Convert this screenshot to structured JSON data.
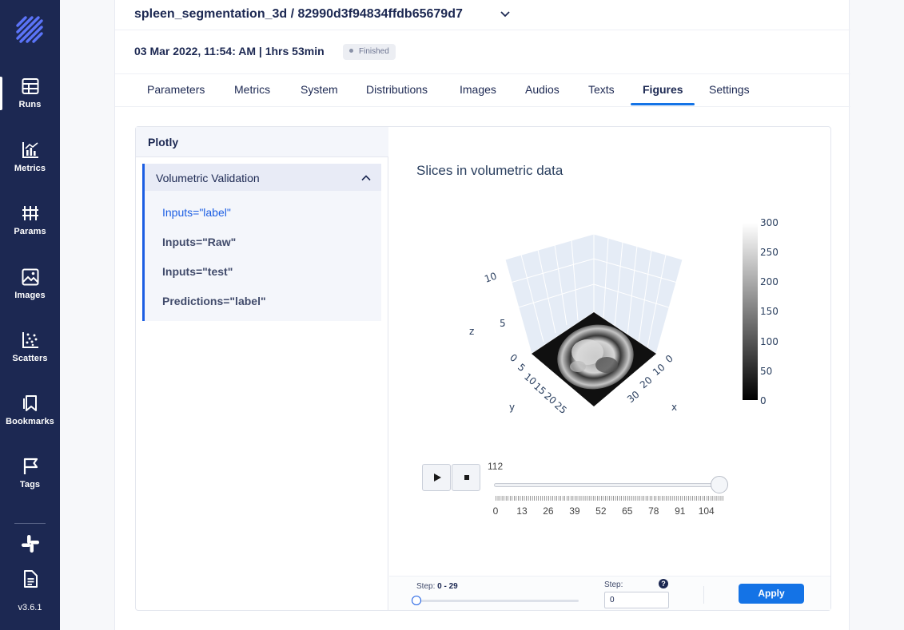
{
  "sidebar": {
    "items": [
      {
        "label": "Runs",
        "icon": "table-icon",
        "active": true
      },
      {
        "label": "Metrics",
        "icon": "bar-chart-icon",
        "active": false
      },
      {
        "label": "Params",
        "icon": "params-icon",
        "active": false
      },
      {
        "label": "Images",
        "icon": "image-icon",
        "active": false
      },
      {
        "label": "Scatters",
        "icon": "scatter-icon",
        "active": false
      },
      {
        "label": "Bookmarks",
        "icon": "bookmark-icon",
        "active": false
      },
      {
        "label": "Tags",
        "icon": "flag-icon",
        "active": false
      }
    ],
    "bottom_icons": [
      "slack-icon",
      "docs-icon"
    ],
    "version": "v3.6.1"
  },
  "header": {
    "run_title": "spleen_segmentation_3d / 82990d3f94834ffdb65679d7"
  },
  "meta": {
    "date": "03 Mar 2022, 11:54: AM | 1hrs 53min",
    "status": "Finished"
  },
  "tabs": [
    {
      "label": "Parameters"
    },
    {
      "label": "Metrics"
    },
    {
      "label": "System"
    },
    {
      "label": "Distributions"
    },
    {
      "label": "Images"
    },
    {
      "label": "Audios"
    },
    {
      "label": "Texts"
    },
    {
      "label": "Figures",
      "active": true
    },
    {
      "label": "Settings"
    }
  ],
  "panel": {
    "section_title": "Plotly",
    "group": {
      "title": "Volumetric Validation",
      "items": [
        {
          "label": "Inputs=\"label\"",
          "active": true
        },
        {
          "label": "Inputs=\"Raw\""
        },
        {
          "label": "Inputs=\"test\""
        },
        {
          "label": "Predictions=\"label\""
        }
      ]
    }
  },
  "plot": {
    "title": "Slices in volumetric data",
    "z_label": "z",
    "y_label": "y",
    "x_label": "x",
    "z_ticks": [
      "10",
      "5"
    ],
    "y_ticks": [
      "0",
      "5",
      "10",
      "15",
      "20",
      "25"
    ],
    "x_ticks": [
      "0",
      "10",
      "20",
      "30"
    ],
    "colorbar_ticks": [
      "300",
      "250",
      "200",
      "150",
      "100",
      "50",
      "0"
    ],
    "colorscale": [
      "#000000",
      "#ffffff"
    ],
    "slider": {
      "value": "112",
      "min": 0,
      "max": 112,
      "tick_labels": [
        "0",
        "13",
        "26",
        "39",
        "52",
        "65",
        "78",
        "91",
        "104"
      ]
    },
    "play_icon": "play-icon",
    "stop_icon": "stop-icon"
  },
  "footer": {
    "step_range_label": "Step:",
    "step_range_value": "0 - 29",
    "step_label": "Step:",
    "step_value": "0",
    "apply_label": "Apply"
  },
  "colors": {
    "sidebar_bg": "#1c2852",
    "accent": "#1473e6",
    "active_link": "#1c5ee3"
  }
}
